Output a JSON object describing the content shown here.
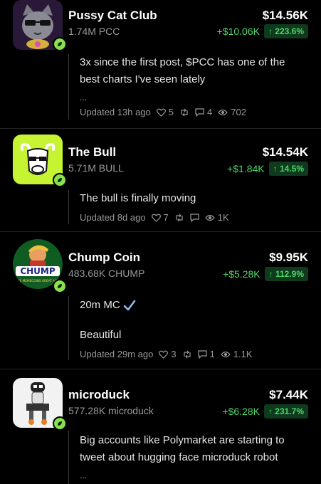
{
  "tokens": [
    {
      "name": "Pussy Cat Club",
      "supply": "1.74M PCC",
      "price": "$14.56K",
      "delta": "+$10.06K",
      "pct": "↑ 223.6%",
      "post_line1": "3x since the first post, $PCC has one of the",
      "post_line2": "best charts I've seen lately",
      "ellipsis": "...",
      "updated": "Updated 13h ago",
      "likes": "5",
      "replies": "4",
      "views": "702"
    },
    {
      "name": "The Bull",
      "supply": "5.71M BULL",
      "price": "$14.54K",
      "delta": "+$1.84K",
      "pct": "↑ 14.5%",
      "post_line1": "The bull is finally moving",
      "updated": "Updated 8d ago",
      "likes": "7",
      "views": "1K"
    },
    {
      "name": "Chump Coin",
      "supply": "483.68K CHUMP",
      "price": "$9.95K",
      "delta": "+$5.28K",
      "pct": "↑ 112.9%",
      "post_line1": "20m MC",
      "post_line2": "Beautiful",
      "updated": "Updated 29m ago",
      "likes": "3",
      "replies": "1",
      "views": "1.1K",
      "logo_text": "CHUMP",
      "logo_sub": "MAKE MEMECOINS GREAT AGAIN"
    },
    {
      "name": "microduck",
      "supply": "577.28K microduck",
      "price": "$7.44K",
      "delta": "+$6.28K",
      "pct": "↑ 231.7%",
      "post_line1": "Big accounts like Polymarket are starting to",
      "post_line2": "tweet about hugging face microduck robot",
      "ellipsis": "..."
    }
  ],
  "colors": {
    "background": "#000000",
    "positive": "#4fd66a",
    "positive_bg": "#0f3a1d",
    "badge": "#8be04e",
    "bull_bg": "#c6f432",
    "muted": "#9a9a9a"
  },
  "icons": [
    "heart-icon",
    "repost-icon",
    "reply-icon",
    "eye-icon",
    "leaf-badge-icon",
    "check-icon"
  ]
}
